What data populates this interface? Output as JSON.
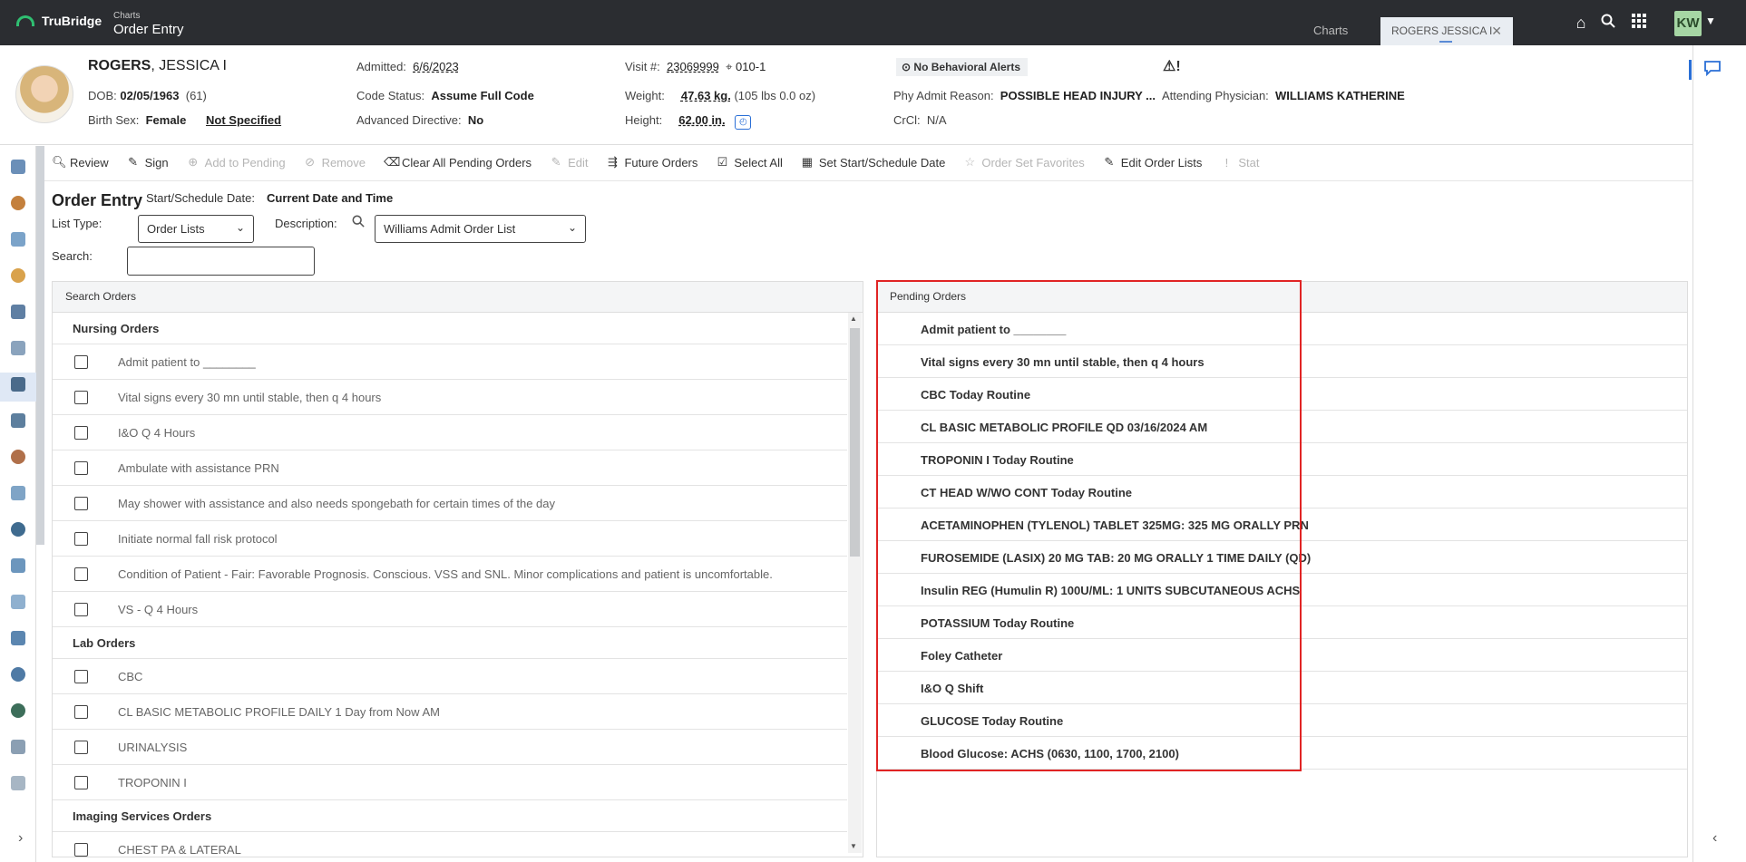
{
  "topbar": {
    "brand": "TruBridge",
    "breadcrumb_sub": "Charts",
    "breadcrumb_main": "Order Entry",
    "tab_charts": "Charts",
    "tab_patient": "ROGERS JESSICA I",
    "user_initials": "KW",
    "icons": [
      "home-icon",
      "search-icon",
      "apps-grid-icon",
      "chevron-down-icon"
    ]
  },
  "patient": {
    "last_name": "ROGERS",
    "first_name": "JESSICA I",
    "dob_label": "DOB:",
    "dob": "02/05/1963",
    "age": "(61)",
    "sex_label": "Birth Sex:",
    "sex": "Female",
    "gender_identity": "Not Specified",
    "admitted_label": "Admitted:",
    "admitted": "6/6/2023",
    "code_status_label": "Code Status:",
    "code_status": "Assume Full Code",
    "adv_directive_label": "Advanced Directive:",
    "adv_directive": "No",
    "visit_label": "Visit #:",
    "visit": "23069999",
    "room": "010-1",
    "weight_label": "Weight:",
    "weight": "47.63 kg.",
    "weight_lbs": "(105 lbs 0.0 oz)",
    "height_label": "Height:",
    "height": "62.00 in.",
    "behavioral_alerts": "No Behavioral Alerts",
    "admit_reason_label": "Phy Admit Reason:",
    "admit_reason": "POSSIBLE HEAD INJURY ...",
    "crcl_label": "CrCl:",
    "crcl": "N/A",
    "attending_label": "Attending Physician:",
    "attending": "WILLIAMS KATHERINE"
  },
  "toolbar": {
    "review": "Review",
    "sign": "Sign",
    "add_to_pending": "Add to Pending",
    "remove": "Remove",
    "clear_all": "Clear All Pending Orders",
    "edit": "Edit",
    "future_orders": "Future Orders",
    "select_all": "Select All",
    "set_date": "Set Start/Schedule Date",
    "order_set_favorites": "Order Set Favorites",
    "edit_order_lists": "Edit Order Lists",
    "stat": "Stat"
  },
  "order_entry": {
    "title": "Order Entry",
    "date_label": "Start/Schedule Date:",
    "date_value": "Current Date and Time",
    "list_type_label": "List Type:",
    "list_type": "Order Lists",
    "description_label": "Description:",
    "description": "Williams Admit Order List",
    "search_label": "Search:",
    "search_value": ""
  },
  "search_orders": {
    "header": "Search Orders",
    "sections": [
      {
        "title": "Nursing Orders",
        "items": [
          "Admit patient to ________",
          "Vital signs every 30 mn until stable, then q 4 hours",
          "I&O Q 4 Hours",
          "Ambulate with assistance PRN",
          "May shower with assistance and also needs spongebath for certain times of the day",
          "Initiate normal fall risk protocol",
          "Condition of Patient - Fair: Favorable Prognosis. Conscious. VSS and SNL. Minor complications and patient is uncomfortable.",
          "VS - Q 4 Hours"
        ]
      },
      {
        "title": "Lab Orders",
        "items": [
          "CBC",
          "CL BASIC METABOLIC PROFILE DAILY 1 Day from Now AM",
          "URINALYSIS",
          "TROPONIN I"
        ]
      },
      {
        "title": "Imaging Services Orders",
        "items": [
          "CHEST PA & LATERAL"
        ]
      }
    ]
  },
  "pending_orders": {
    "header": "Pending Orders",
    "items": [
      "Admit patient to ________",
      "Vital signs every 30 mn until stable, then q 4 hours",
      "CBC Today Routine",
      "CL BASIC METABOLIC PROFILE QD 03/16/2024 AM",
      "TROPONIN I Today Routine",
      "CT HEAD W/WO CONT Today Routine",
      "ACETAMINOPHEN (TYLENOL) TABLET 325MG: 325 MG ORALLY PRN",
      "FUROSEMIDE (LASIX) 20 MG TAB: 20 MG ORALLY 1 TIME DAILY (QD)",
      "Insulin REG (Humulin R) 100U/ML: 1 UNITS SUBCUTANEOUS ACHS",
      "POTASSIUM Today Routine",
      "Foley Catheter",
      "I&O Q Shift",
      "GLUCOSE Today Routine",
      "Blood Glucose: ACHS (0630, 1100, 1700, 2100)"
    ]
  },
  "colors": {
    "topbar": "#2b2d31",
    "highlight": "#e02424",
    "accent": "#2a6fd6",
    "brand_green": "#2fbf71"
  }
}
